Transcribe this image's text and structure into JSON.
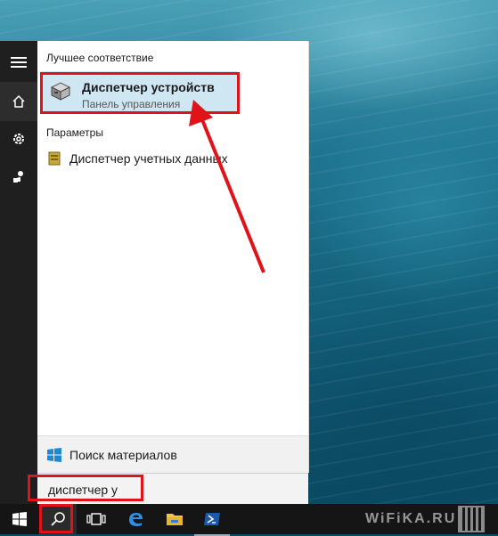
{
  "start_menu": {
    "best_match_title": "Лучшее соответствие",
    "best_match": {
      "title": "Диспетчер устройств",
      "subtitle": "Панель управления",
      "icon": "device-manager-icon"
    },
    "settings_title": "Параметры",
    "settings_items": [
      {
        "label": "Диспетчер учетных данных",
        "icon": "credential-manager-icon"
      }
    ],
    "web_search_label": "Поиск материалов",
    "search_query": "диспетчер у"
  },
  "left_rail": {
    "items": [
      "hamburger-icon",
      "home-icon",
      "settings-icon",
      "user-icon"
    ]
  },
  "taskbar": {
    "items": [
      "windows-start-icon",
      "search-icon",
      "task-view-icon",
      "edge-icon",
      "file-explorer-icon",
      "powershell-icon"
    ]
  },
  "watermark": "WiFiKA.RU",
  "colors": {
    "annotation_red": "#e0131a",
    "selected_bg": "#cfe7f3",
    "taskbar": "#151515",
    "left_rail": "#1f1f1f"
  }
}
